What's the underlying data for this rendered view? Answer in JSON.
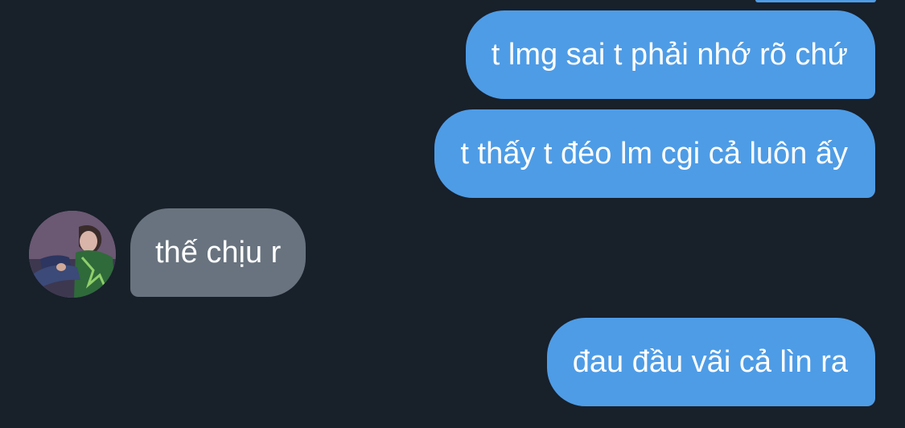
{
  "conversation": {
    "messages": [
      {
        "direction": "sent",
        "text": "t lmg sai t phải nhớ rõ chứ"
      },
      {
        "direction": "sent",
        "text": "t thấy t đéo lm cgi cả luôn ấy"
      },
      {
        "direction": "received",
        "text": "thế chịu r",
        "avatar": "contact-avatar"
      },
      {
        "direction": "sent",
        "text": "đau đầu vãi cả lìn ra"
      }
    ]
  },
  "colors": {
    "background": "#18202a",
    "sent_bubble": "#4e9ce6",
    "received_bubble": "#68737f",
    "text": "#ffffff"
  }
}
